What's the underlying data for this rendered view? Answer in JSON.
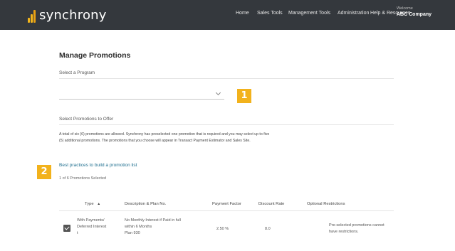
{
  "header": {
    "logo_text": "synchrony",
    "nav": [
      "Home",
      "Sales Tools",
      "Management Tools",
      "Administration",
      "Help & Resources"
    ],
    "welcome_label": "Welcome",
    "company_name": "ABC Company"
  },
  "main": {
    "title": "Manage Promotions",
    "program_label": "Select a Program",
    "program_value": "",
    "offer_label": "Select Promotions to Offer",
    "description_line1": "A total of six (6) promotions are allowed. Synchrony has preselected one promotion that is required and you may select up to five",
    "description_line2": "(5) additional promotions. The promotions that you choose will appear in Transact Payment Estimator and Sales Site.",
    "best_practices_link": "Best practices to build a promotion list",
    "selected_count": "1 of 6 Promotions Selected"
  },
  "callouts": [
    "1",
    "2"
  ],
  "table": {
    "headers": [
      "Type",
      "Description & Plan No.",
      "Payment Factor",
      "Discount Rate",
      "Optional Restrictions"
    ],
    "sort_indicator": "▲",
    "rows": [
      {
        "type_lines": [
          "With Payments/",
          "Deferred Interest",
          "t"
        ],
        "desc_lines": [
          "No Monthly Interest if Paid in full",
          "within 6 Months",
          "Plan 930"
        ],
        "payment_factor": "2.50 %",
        "discount_rate": "8.0",
        "restriction_lines": [
          "Pre-selected promotions cannot",
          "have restrictions."
        ],
        "checked": true
      }
    ]
  },
  "colors": {
    "header_bg": "#34383d",
    "accent": "#f2b21c",
    "link": "#1f6f8f"
  }
}
